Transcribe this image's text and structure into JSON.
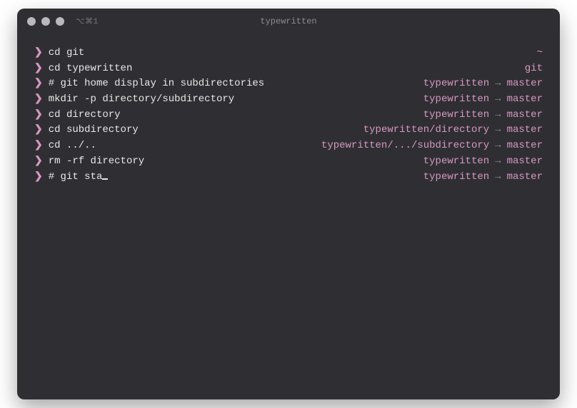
{
  "window": {
    "title": "typewritten",
    "hint": "⌥⌘1"
  },
  "prompt": {
    "caret": "❯",
    "arrow": "→"
  },
  "lines": [
    {
      "command": "cd git",
      "right_mode": "plain",
      "right_plain": "~"
    },
    {
      "command": "cd typewritten",
      "right_mode": "plain",
      "right_plain": "git"
    },
    {
      "command": "# git home display in subdirectories",
      "right_mode": "git",
      "cwd": "typewritten",
      "branch": "master"
    },
    {
      "command": "mkdir -p directory/subdirectory",
      "right_mode": "git",
      "cwd": "typewritten",
      "branch": "master"
    },
    {
      "command": "cd directory",
      "right_mode": "git",
      "cwd": "typewritten",
      "branch": "master"
    },
    {
      "command": "cd subdirectory",
      "right_mode": "git",
      "cwd": "typewritten/directory",
      "branch": "master"
    },
    {
      "command": "cd ../..",
      "right_mode": "git",
      "cwd": "typewritten/.../subdirectory",
      "branch": "master"
    },
    {
      "command": "rm -rf directory",
      "right_mode": "git",
      "cwd": "typewritten",
      "branch": "master"
    },
    {
      "command": "# git sta",
      "right_mode": "git",
      "cwd": "typewritten",
      "branch": "master",
      "has_cursor": true
    }
  ]
}
